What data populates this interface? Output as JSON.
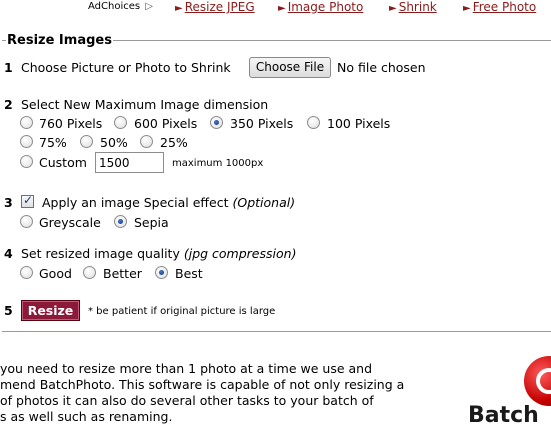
{
  "top": {
    "adchoices": "AdChoices",
    "links": [
      {
        "label": "Resize JPEG"
      },
      {
        "label": "Image Photo"
      },
      {
        "label": "Shrink"
      },
      {
        "label": "Free Photo"
      }
    ],
    "arrow_glyph": "►"
  },
  "form": {
    "legend": "Resize Images",
    "step1": {
      "num": "1",
      "label": "Choose Picture or Photo to Shrink",
      "button": "Choose File",
      "status": "No file chosen"
    },
    "step2": {
      "num": "2",
      "label": "Select New Maximum Image dimension",
      "options": [
        {
          "label": "760 Pixels",
          "checked": false
        },
        {
          "label": "600 Pixels",
          "checked": false
        },
        {
          "label": "350 Pixels",
          "checked": true
        },
        {
          "label": "100 Pixels",
          "checked": false
        },
        {
          "label": "75%",
          "checked": false
        },
        {
          "label": "50%",
          "checked": false
        },
        {
          "label": "25%",
          "checked": false
        },
        {
          "label": "Custom",
          "checked": false
        }
      ],
      "custom_value": "1500",
      "custom_hint": "maximum 1000px"
    },
    "step3": {
      "num": "3",
      "label": "Apply an image Special effect",
      "optional": "(Optional)",
      "checked": true,
      "options": [
        {
          "label": "Greyscale",
          "checked": false
        },
        {
          "label": "Sepia",
          "checked": true
        }
      ]
    },
    "step4": {
      "num": "4",
      "label": "Set resized image quality",
      "optional": "(jpg compression)",
      "options": [
        {
          "label": "Good",
          "checked": false
        },
        {
          "label": "Better",
          "checked": false
        },
        {
          "label": "Best",
          "checked": true
        }
      ]
    },
    "step5": {
      "num": "5",
      "button": "Resize",
      "note": "* be patient if original picture is large"
    }
  },
  "paragraph": {
    "lines": [
      "you need to resize more than 1 photo at a time we use and",
      "mend BatchPhoto. This software is capable of not only resizing a",
      "of photos it can also do several other tasks to your batch of",
      "s as well such as renaming."
    ]
  },
  "logo": {
    "text": "Batch"
  },
  "colors": {
    "link": "#8b1a1a",
    "resize_button": "#8b1a3a",
    "logo_red": "#c40000"
  }
}
